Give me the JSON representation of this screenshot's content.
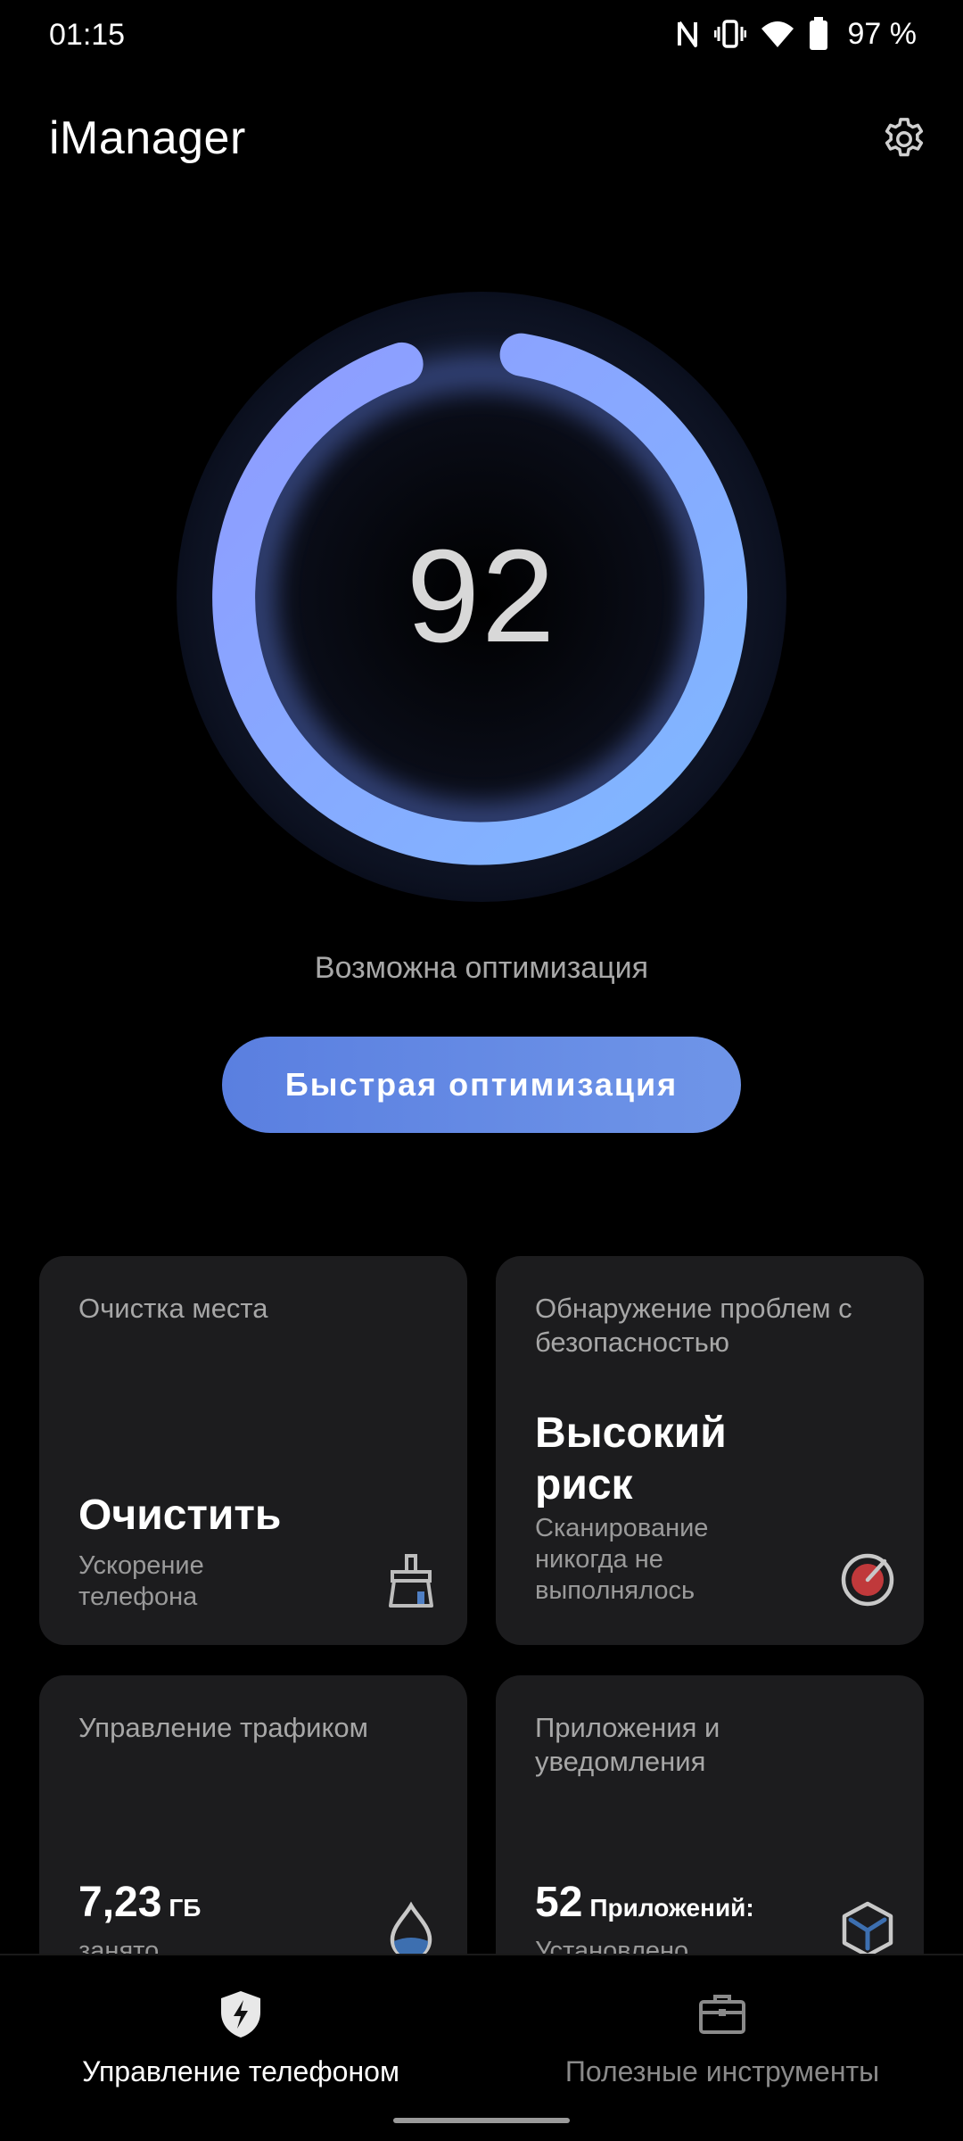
{
  "status_bar": {
    "time": "01:15",
    "battery": "97 %"
  },
  "header": {
    "title": "iManager"
  },
  "score": {
    "value": "92",
    "status": "Возможна оптимизация",
    "action_label": "Быстрая оптимизация"
  },
  "cards": {
    "cleanup": {
      "title": "Очистка места",
      "main": "Очистить",
      "sub": "Ускорение телефона"
    },
    "security": {
      "title": "Обнаружение проблем с безопасностью",
      "main": "Высокий риск",
      "sub": "Сканирование никогда не выполнялось"
    },
    "traffic": {
      "title": "Управление трафиком",
      "value": "7,23",
      "unit": "ГБ",
      "sub": "занято"
    },
    "apps": {
      "title": "Приложения и уведомления",
      "value": "52",
      "unit": "Приложений:",
      "sub": "Установлено"
    }
  },
  "bottom_nav": {
    "items": [
      {
        "label": "Управление телефоном",
        "active": true
      },
      {
        "label": "Полезные инструменты",
        "active": false
      }
    ]
  },
  "colors": {
    "accent": "#6f95e8",
    "ring_start": "#8fa0ff",
    "ring_end": "#7fb7ff",
    "card_bg": "#1c1c1e",
    "risk_red": "#c0393b",
    "icon_blue": "#3d6fb0"
  }
}
